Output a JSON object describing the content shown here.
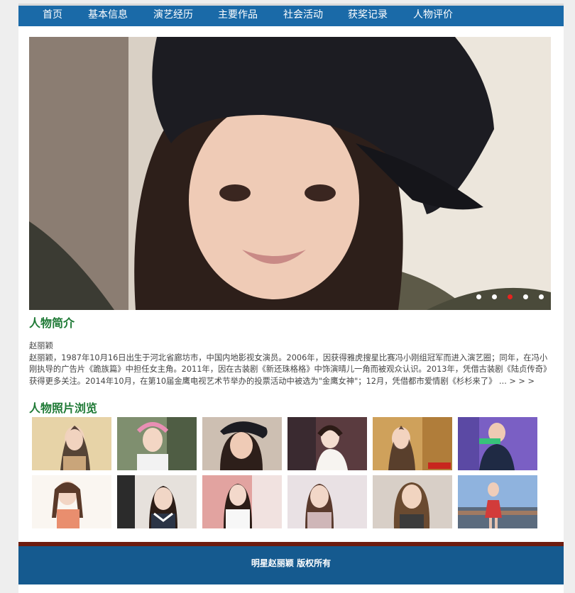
{
  "nav": {
    "items": [
      {
        "label": "首页"
      },
      {
        "label": "基本信息"
      },
      {
        "label": "演艺经历"
      },
      {
        "label": "主要作品"
      },
      {
        "label": "社会活动"
      },
      {
        "label": "获奖记录"
      },
      {
        "label": "人物评价"
      }
    ]
  },
  "carousel": {
    "slide_count": 5,
    "active_index": 3,
    "dot_colors": {
      "inactive": "#ffffff",
      "active": "#e8231f"
    }
  },
  "profile": {
    "title": "人物简介",
    "name": "赵丽颖",
    "bio": "赵丽颖，1987年10月16日出生于河北省廊坊市，中国内地影视女演员。2006年，因获得雅虎搜星比赛冯小刚组冠军而进入演艺圈；同年，在冯小刚执导的广告片《跪族篇》中担任女主角。2011年，因在古装剧《新还珠格格》中饰演晴儿一角而被观众认识。2013年，凭借古装剧《陆贞传奇》获得更多关注。2014年10月，在第10届金鹰电视艺术节举办的投票活动中被选为\"金鹰女神\"；12月，凭借都市爱情剧《杉杉来了》",
    "more": " ... > > >"
  },
  "gallery": {
    "title": "人物照片浏览",
    "photo_count": 12
  },
  "footer": {
    "text": "明星赵丽颖 版权所有"
  },
  "colors": {
    "nav_bg": "#1a6aa8",
    "heading": "#1f7a36",
    "footer_bg": "#155a8f",
    "footer_stripe": "#6e1c0f"
  }
}
